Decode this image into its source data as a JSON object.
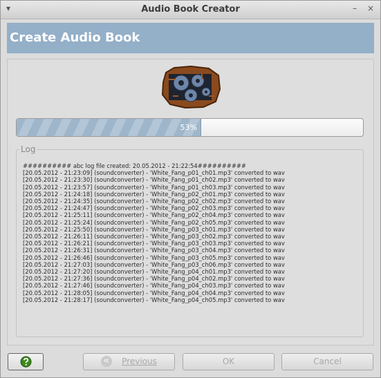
{
  "window": {
    "title": "Audio Book Creator",
    "menu_icon": "▾",
    "minimize_icon": "–",
    "close_icon": "×"
  },
  "header": {
    "title": "Create Audio Book"
  },
  "progress": {
    "value": 0.53,
    "label": "53%"
  },
  "log": {
    "legend": "Log",
    "lines": [
      "########## abc log file created: 20.05.2012 - 21:22:54##########",
      "[20.05.2012 - 21:23:09] (soundconverter) - 'White_Fang_p01_ch01.mp3' converted to wav",
      "[20.05.2012 - 21:23:30] (soundconverter) - 'White_Fang_p01_ch02.mp3' converted to wav",
      "[20.05.2012 - 21:23:57] (soundconverter) - 'White_Fang_p01_ch03.mp3' converted to wav",
      "[20.05.2012 - 21:24:18] (soundconverter) - 'White_Fang_p02_ch01.mp3' converted to wav",
      "[20.05.2012 - 21:24:35] (soundconverter) - 'White_Fang_p02_ch02.mp3' converted to wav",
      "[20.05.2012 - 21:24:47] (soundconverter) - 'White_Fang_p02_ch03.mp3' converted to wav",
      "[20.05.2012 - 21:25:11] (soundconverter) - 'White_Fang_p02_ch04.mp3' converted to wav",
      "[20.05.2012 - 21:25:24] (soundconverter) - 'White_Fang_p02_ch05.mp3' converted to wav",
      "[20.05.2012 - 21:25:50] (soundconverter) - 'White_Fang_p03_ch01.mp3' converted to wav",
      "[20.05.2012 - 21:26:11] (soundconverter) - 'White_Fang_p03_ch02.mp3' converted to wav",
      "[20.05.2012 - 21:26:21] (soundconverter) - 'White_Fang_p03_ch03.mp3' converted to wav",
      "[20.05.2012 - 21:26:31] (soundconverter) - 'White_Fang_p03_ch04.mp3' converted to wav",
      "[20.05.2012 - 21:26:46] (soundconverter) - 'White_Fang_p03_ch05.mp3' converted to wav",
      "[20.05.2012 - 21:27:03] (soundconverter) - 'White_Fang_p03_ch06.mp3' converted to wav",
      "[20.05.2012 - 21:27:20] (soundconverter) - 'White_Fang_p04_ch01.mp3' converted to wav",
      "[20.05.2012 - 21:27:36] (soundconverter) - 'White_Fang_p04_ch02.mp3' converted to wav",
      "[20.05.2012 - 21:27:46] (soundconverter) - 'White_Fang_p04_ch03.mp3' converted to wav",
      "[20.05.2012 - 21:28:05] (soundconverter) - 'White_Fang_p04_ch04.mp3' converted to wav",
      "[20.05.2012 - 21:28:17] (soundconverter) - 'White_Fang_p04_ch05.mp3' converted to wav"
    ]
  },
  "buttons": {
    "help_icon": "help-icon",
    "previous_label": "Previous",
    "ok_label": "OK",
    "cancel_label": "Cancel"
  },
  "colors": {
    "header_bg": "#94afc8",
    "progress_fill": "#9fb6ca"
  }
}
